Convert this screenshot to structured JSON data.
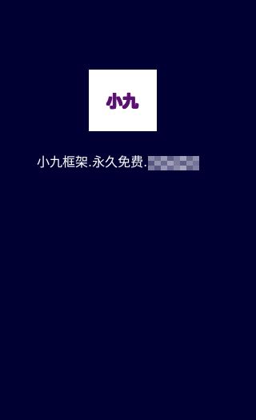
{
  "logo": {
    "text": "小九"
  },
  "tagline": {
    "text": "小九框架.永久免费."
  },
  "colors": {
    "background": "#010033",
    "logo_background": "#ffffff",
    "logo_text_outline": "#7a1a8f",
    "text": "#ffffff"
  }
}
